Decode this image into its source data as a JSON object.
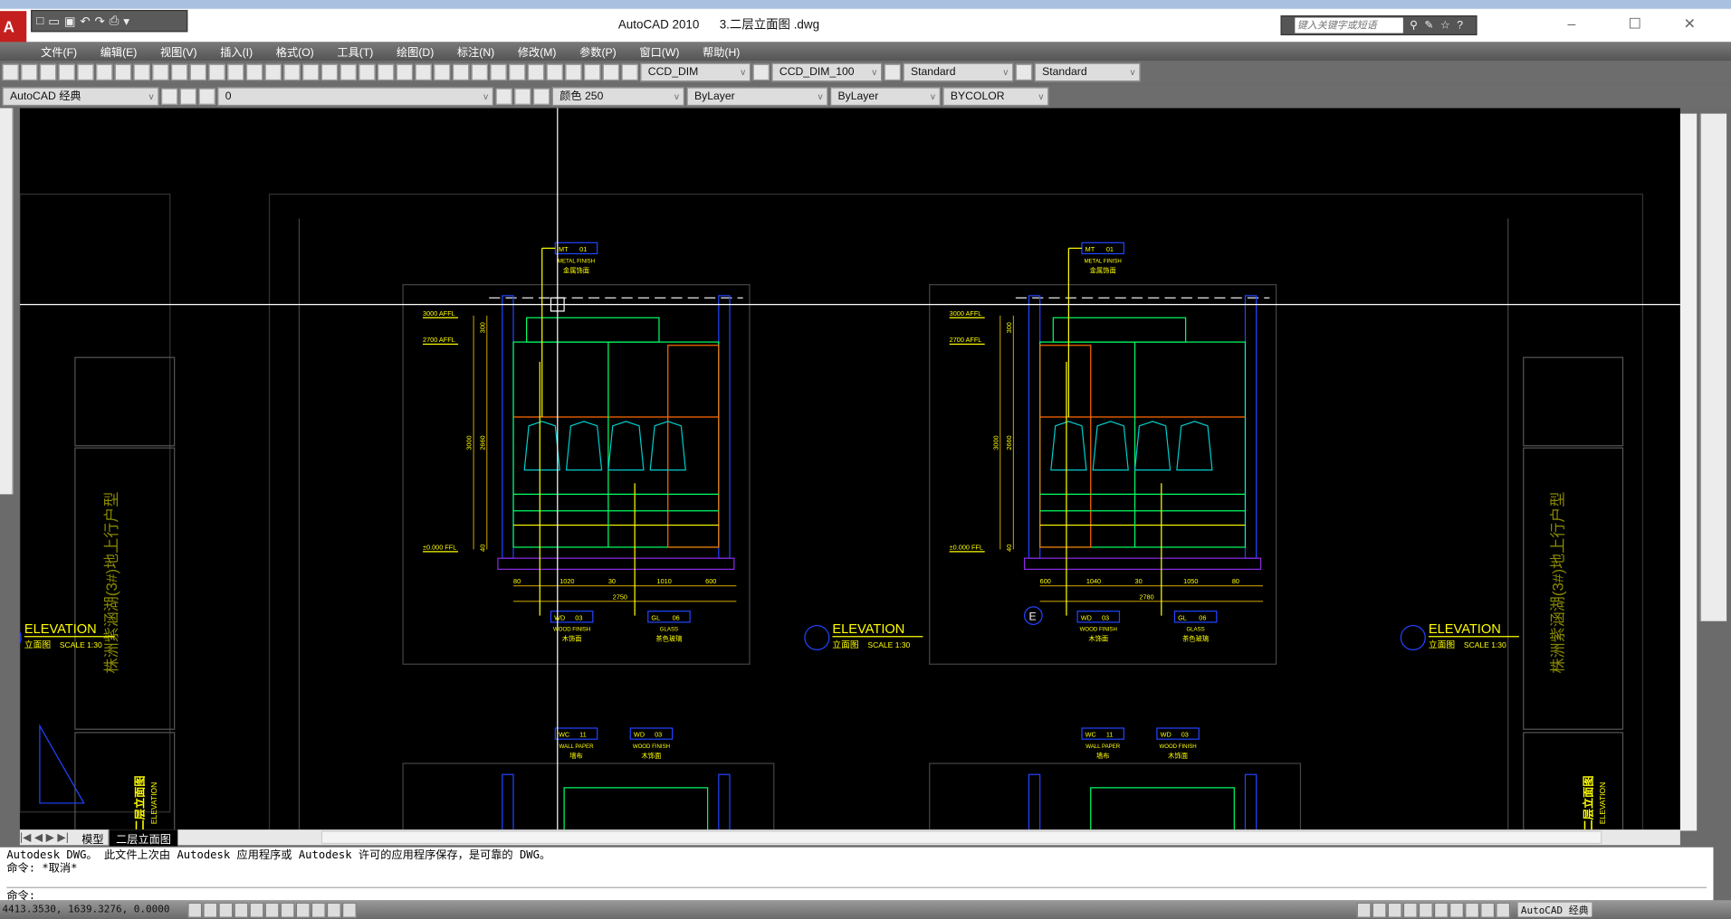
{
  "window": {
    "app": "AutoCAD 2010",
    "file": "3.二层立面图 .dwg",
    "search_placeholder": "键入关键字或短语"
  },
  "menu": [
    "文件(F)",
    "编辑(E)",
    "视图(V)",
    "插入(I)",
    "格式(O)",
    "工具(T)",
    "绘图(D)",
    "标注(N)",
    "修改(M)",
    "参数(P)",
    "窗口(W)",
    "帮助(H)"
  ],
  "toolbar1": {
    "text_style": "CCD_DIM",
    "dim_style": "CCD_DIM_100",
    "table_style": "Standard",
    "mleader_style": "Standard"
  },
  "toolbar2": {
    "workspace": "AutoCAD 经典",
    "layer": "0",
    "color": "颜色 250",
    "linetype": "ByLayer",
    "lineweight": "ByLayer",
    "plotstyle": "BYCOLOR"
  },
  "tabs": [
    "模型",
    "二层立面图"
  ],
  "command": {
    "history": [
      "Autodesk DWG。  此文件上次由 Autodesk 应用程序或 Autodesk 许可的应用程序保存，是可靠的 DWG。",
      "命令: *取消*"
    ],
    "prompt": "命令:"
  },
  "status": {
    "coords": "4413.3530, 1639.3276, 0.0000",
    "workspace": "AutoCAD 经典"
  },
  "drawing": {
    "elevation_title": "ELEVATION",
    "elevation_cn": "立面图",
    "scale": "SCALE  1:30",
    "project": "株洲紫涵湖(3#)地上行户型",
    "sheet_cn": "二层立面图",
    "sheet_en": "ELEVATION",
    "tag_e": "E",
    "levels": [
      "3000 AFFL",
      "2700 AFFL",
      "±0.000 FFL"
    ],
    "vert_dims": [
      "300",
      "3000",
      "2660",
      "40"
    ],
    "left_dims": [
      "80",
      "1020",
      "30",
      "1010",
      "600"
    ],
    "left_total": "2750",
    "right_dims": [
      "600",
      "1040",
      "30",
      "1050",
      "80"
    ],
    "right_total": "2780",
    "tags": {
      "metal": {
        "code": "MT",
        "num": "01",
        "en": "METAL FINISH",
        "cn": "金属饰面"
      },
      "wood": {
        "code": "WD",
        "num": "03",
        "en": "WOOD FINISH",
        "cn": "木饰面"
      },
      "glass": {
        "code": "GL",
        "num": "06",
        "en": "GLASS",
        "cn": "茶色玻璃"
      },
      "wall": {
        "code": "WC",
        "num": "11",
        "en": "WALL PAPER",
        "cn": "墙布"
      },
      "wood2": {
        "code": "WD",
        "num": "03",
        "en": "WOOD FINISH",
        "cn": "木饰面"
      }
    }
  },
  "colors": {
    "canvas": "#000000",
    "yellow": "#ffff00",
    "green": "#00ff66",
    "orange": "#ff6a00",
    "blue": "#2244ff",
    "cyan": "#00cccc",
    "purple": "#8a2be2"
  }
}
